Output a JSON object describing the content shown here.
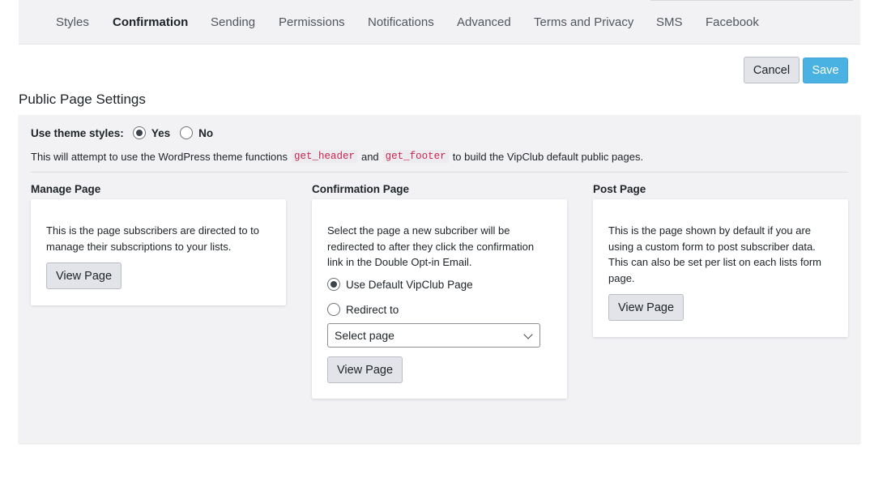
{
  "tabs": [
    {
      "label": "Styles",
      "active": false
    },
    {
      "label": "Confirmation",
      "active": true
    },
    {
      "label": "Sending",
      "active": false
    },
    {
      "label": "Permissions",
      "active": false
    },
    {
      "label": "Notifications",
      "active": false
    },
    {
      "label": "Advanced",
      "active": false
    },
    {
      "label": "Terms and Privacy",
      "active": false
    },
    {
      "label": "SMS",
      "active": false
    },
    {
      "label": "Facebook",
      "active": false
    }
  ],
  "actions": {
    "cancel_label": "Cancel",
    "save_label": "Save"
  },
  "section_title": "Public Page Settings",
  "theme_styles": {
    "label": "Use theme styles:",
    "yes_label": "Yes",
    "no_label": "No",
    "selected": "Yes"
  },
  "description": {
    "before": "This will attempt to use the WordPress theme functions",
    "code1": "get_header",
    "middle": "and",
    "code2": "get_footer",
    "after": "to build the VipClub default public pages."
  },
  "manage_page": {
    "title": "Manage Page",
    "text": "This is the page subscribers are directed to to manage their subscriptions to your lists.",
    "button_label": "View Page"
  },
  "confirmation_page": {
    "title": "Confirmation Page",
    "text": "Select the page a new subcriber will be redirected to after they click the confirmation link in the Double Opt-in Email.",
    "option_default": "Use Default VipClub Page",
    "option_redirect": "Redirect to",
    "selected_option": "Use Default VipClub Page",
    "select_value": "Select page",
    "button_label": "View Page"
  },
  "post_page": {
    "title": "Post Page",
    "text": "This is the page shown by default if you are using a custom form to post subscriber data. This can also be set per list on each lists form page.",
    "button_label": "View Page"
  },
  "colors": {
    "accent": "#4ab2e3",
    "panel_bg": "#f2f2f5",
    "code_text": "#c7254e"
  }
}
